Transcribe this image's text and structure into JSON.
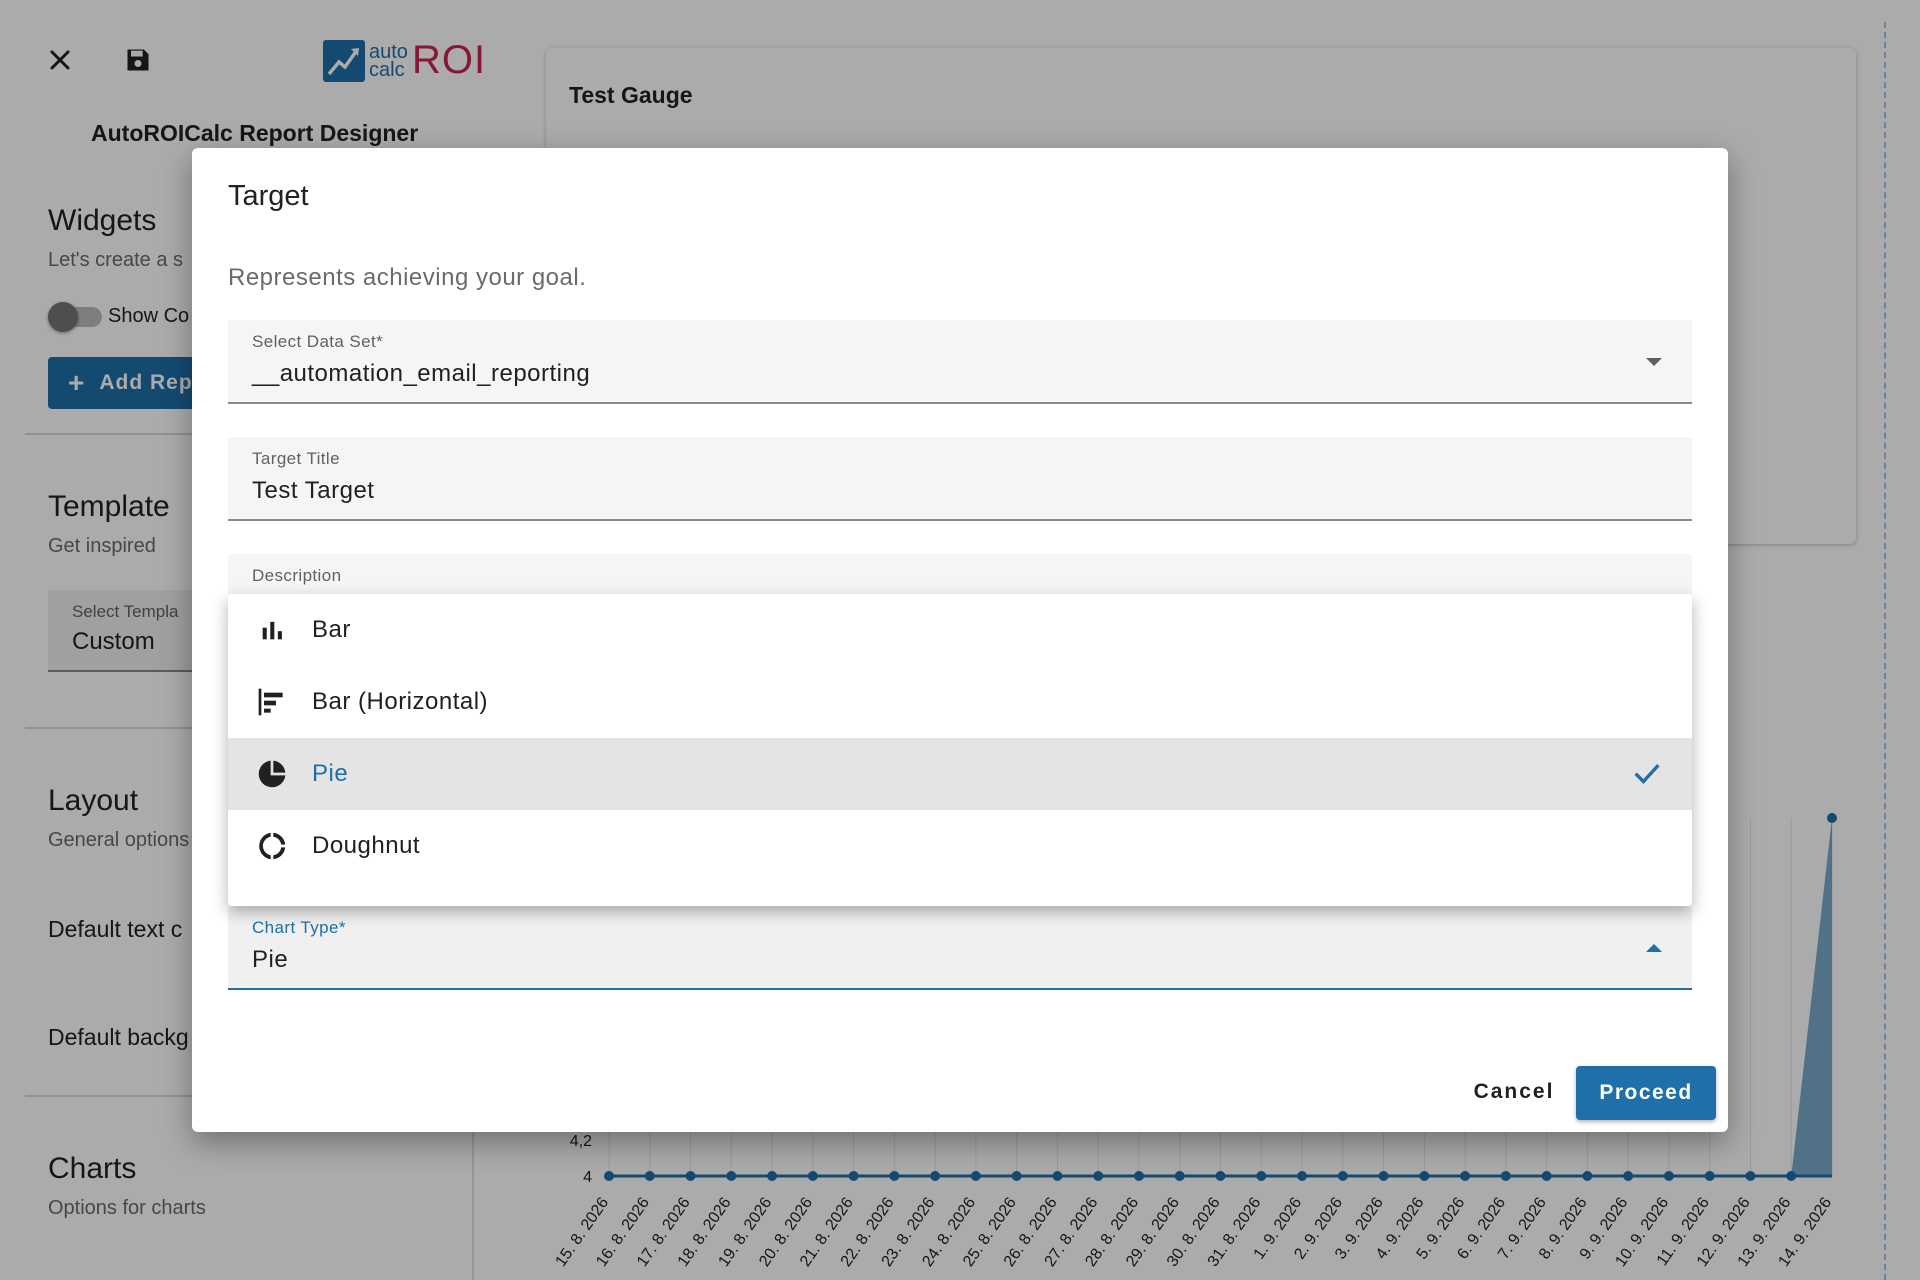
{
  "app": {
    "logo": {
      "auto": "auto",
      "calc": "calc",
      "roi": "ROI"
    },
    "designer_title": "AutoROICalc Report Designer",
    "toolbar": {
      "close_icon": "close-icon",
      "save_icon": "save-icon"
    }
  },
  "sidebar": {
    "widgets": {
      "title": "Widgets",
      "subtitle": "Let's create a s",
      "toggle_label": "Show Co",
      "add_button": "Add Rep"
    },
    "template": {
      "title": "Template",
      "subtitle": "Get inspired",
      "select_label": "Select Templa",
      "select_value": "Custom"
    },
    "layout": {
      "title": "Layout",
      "subtitle": "General options",
      "text_color_label": "Default text c",
      "background_label": "Default backg"
    },
    "charts": {
      "title": "Charts",
      "subtitle": "Options for charts"
    }
  },
  "canvas": {
    "card_title": "Test Gauge",
    "chart": {
      "y_ticks": [
        "4,2",
        "4"
      ],
      "dates": [
        "15. 8. 2026",
        "16. 8. 2026",
        "17. 8. 2026",
        "18. 8. 2026",
        "19. 8. 2026",
        "20. 8. 2026",
        "21. 8. 2026",
        "22. 8. 2026",
        "23. 8. 2026",
        "24. 8. 2026",
        "25. 8. 2026",
        "26. 8. 2026",
        "27. 8. 2026",
        "28. 8. 2026",
        "29. 8. 2026",
        "30. 8. 2026",
        "31. 8. 2026",
        "1. 9. 2026",
        "2. 9. 2026",
        "3. 9. 2026",
        "4. 9. 2026",
        "5. 9. 2026",
        "6. 9. 2026",
        "7. 9. 2026",
        "8. 9. 2026",
        "9. 9. 2026",
        "10. 9. 2026",
        "11. 9. 2026",
        "12. 9. 2026",
        "13. 9. 2026",
        "14. 9. 2026"
      ],
      "color": "#1f6fa8"
    }
  },
  "dialog": {
    "title": "Target",
    "description_text": "Represents achieving your goal.",
    "dataset_field": {
      "label": "Select Data Set*",
      "value": "__automation_email_reporting"
    },
    "title_field": {
      "label": "Target Title",
      "value": "Test Target"
    },
    "description_field": {
      "label": "Description"
    },
    "chart_type_field": {
      "label": "Chart Type*",
      "value": "Pie"
    },
    "menu": {
      "items": [
        {
          "label": "Bar",
          "icon": "bar-chart-icon"
        },
        {
          "label": "Bar (Horizontal)",
          "icon": "bar-horizontal-icon"
        },
        {
          "label": "Pie",
          "icon": "pie-chart-icon",
          "selected": true
        },
        {
          "label": "Doughnut",
          "icon": "doughnut-icon"
        }
      ]
    },
    "cancel_label": "Cancel",
    "proceed_label": "Proceed"
  },
  "colors": {
    "accent": "#1f6fa8",
    "brand_red": "#c8254f"
  }
}
